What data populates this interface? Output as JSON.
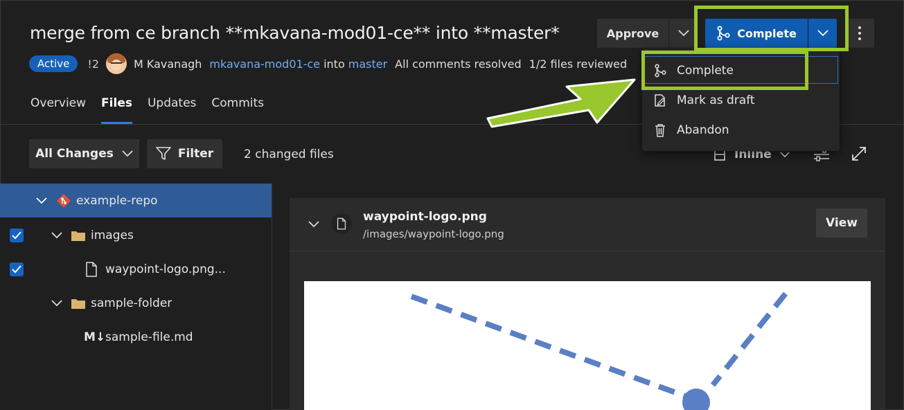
{
  "pr": {
    "title": "merge from ce branch **mkavana-mod01-ce** into **master*",
    "status": "Active",
    "pr_count": "!2",
    "author": "M Kavanagh",
    "source_branch": "mkavana-mod01-ce",
    "into": "into",
    "target_branch": "master",
    "comments": "All comments resolved",
    "files_reviewed": "1/2 files reviewed"
  },
  "tabs": [
    {
      "label": "Overview"
    },
    {
      "label": "Files",
      "active": true
    },
    {
      "label": "Updates"
    },
    {
      "label": "Commits"
    }
  ],
  "actions": {
    "approve": "Approve",
    "complete": "Complete"
  },
  "menu": {
    "items": [
      {
        "label": "Complete",
        "icon": "merge-icon"
      },
      {
        "label": "Mark as draft",
        "icon": "draft-icon"
      },
      {
        "label": "Abandon",
        "icon": "trash-icon"
      }
    ]
  },
  "toolbar": {
    "all_changes": "All Changes",
    "filter": "Filter",
    "changed_files": "2 changed files",
    "view_mode": "Inline"
  },
  "tree": {
    "repo": "example-repo",
    "items": [
      {
        "label": "images",
        "type": "folder",
        "checked": true
      },
      {
        "label": "waypoint-logo.png...",
        "type": "file",
        "checked": true
      },
      {
        "label": "sample-folder",
        "type": "folder",
        "checked": false
      },
      {
        "label": "sample-file.md",
        "type": "markdown",
        "checked": false,
        "prefix": "M↓"
      }
    ]
  },
  "file_panel": {
    "name": "waypoint-logo.png",
    "path": "/images/waypoint-logo.png",
    "view_label": "View"
  },
  "colors": {
    "accent": "#0f5cb0",
    "highlight": "#98c72e",
    "link": "#6fb0f5",
    "diagram": "#5b7fc4"
  }
}
